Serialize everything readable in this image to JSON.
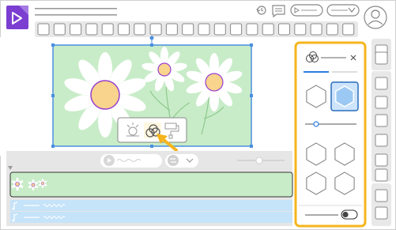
{
  "app": {
    "logo_icon": "play-triangle-icon",
    "accent_color": "#7b3ed1"
  },
  "header": {
    "title_placeholder": "",
    "actions": [
      "history-icon",
      "comment-icon",
      "play-pill",
      "dropdown-pill",
      "avatar"
    ]
  },
  "toolbar": {
    "slots": 20
  },
  "canvas": {
    "background_color": "#c8ecc8",
    "border_color": "#4a8fe0",
    "flowers": 3
  },
  "context_menu": {
    "items": [
      "adjust-icon",
      "blend-rings-icon",
      "paint-roller-icon"
    ],
    "highlight_color": "#f5b51c"
  },
  "timeline": {
    "play_icon": "play-icon",
    "scrubber_icon": "slider-knob-icon",
    "video_clip": "flower-clip",
    "audio_tracks": 2
  },
  "blend_panel": {
    "header_icon": "blend-rings-icon",
    "close_label": "×",
    "tabs": 2,
    "active_tab": 0,
    "shapes": 6,
    "selected_shape": 1,
    "slider_value": 0.2,
    "toggle_on": true,
    "highlight_color": "#f5b51c"
  },
  "right_rail": {
    "slots": 10
  }
}
